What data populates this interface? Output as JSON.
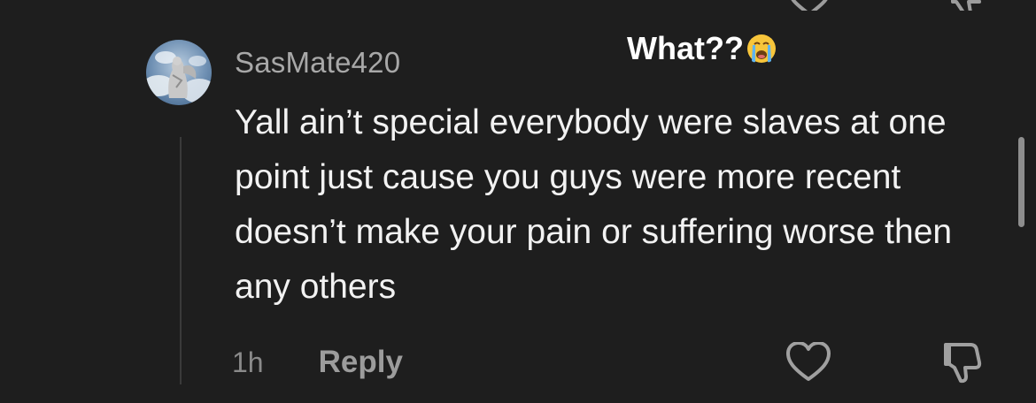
{
  "comment": {
    "username": "SasMate420",
    "text": "Yall ain’t special everybody were slaves at one point just cause you guys were more recent doesn’t make your pain or suffering worse then any others",
    "timestamp": "1h",
    "reply_label": "Reply",
    "avatar_icon": "avatar-angel-statue"
  },
  "overlay": {
    "caption": "What??",
    "emoji_icon": "crying-face-emoji"
  },
  "icons": {
    "like": "heart-icon",
    "dislike": "thumbs-down-icon"
  },
  "colors": {
    "background": "#1e1e1e",
    "username": "#a8a8a8",
    "body_text": "#f2f2f2",
    "meta_text": "#8a8a8a",
    "thread_line": "#3a3a3a"
  }
}
